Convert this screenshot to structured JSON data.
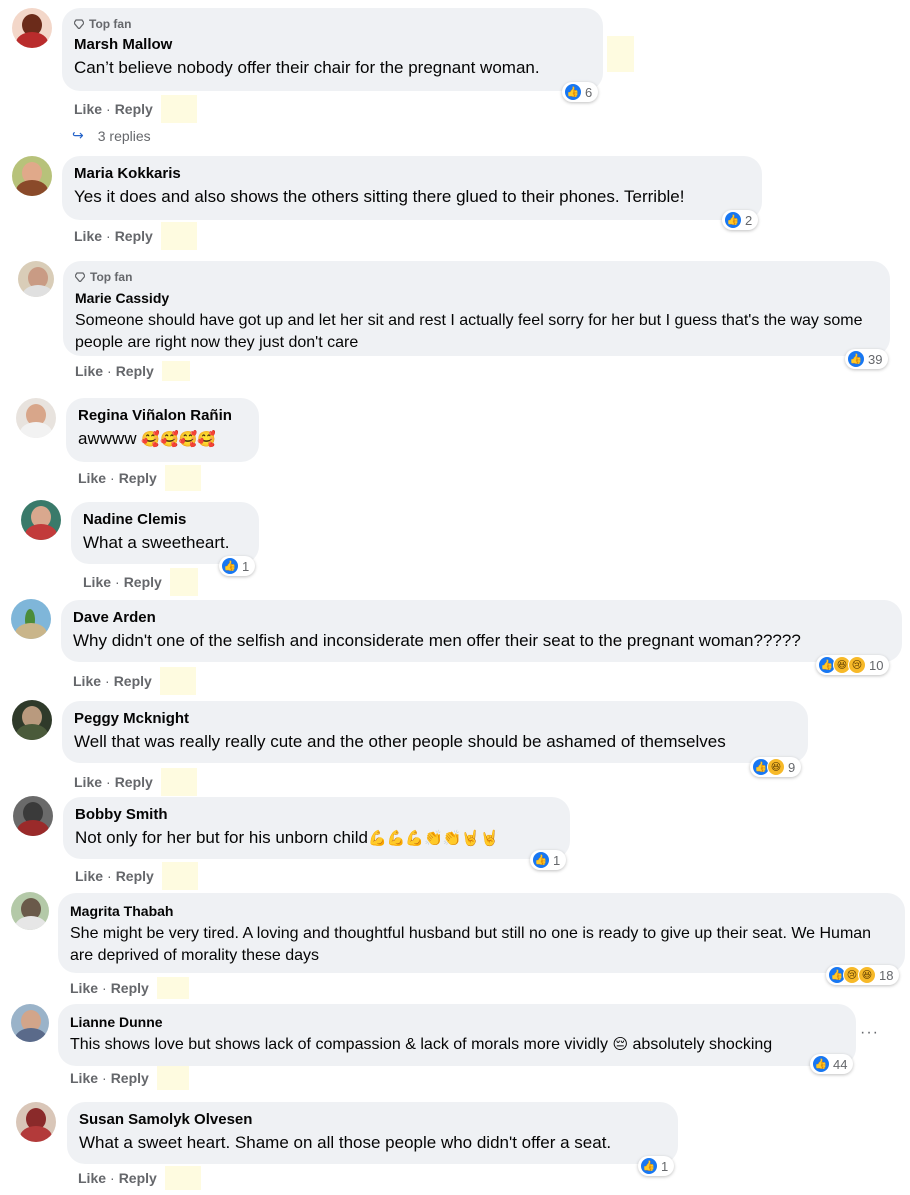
{
  "labels": {
    "top_fan": "Top fan",
    "like": "Like",
    "reply": "Reply",
    "dot": "·"
  },
  "comments": [
    {
      "author": "Marsh Mallow",
      "top_fan": true,
      "text": "Can’t believe nobody offer their chair for the pregnant woman.",
      "reactions": [
        "like"
      ],
      "count": "6",
      "replies": "3 replies"
    },
    {
      "author": "Maria Kokkaris",
      "top_fan": false,
      "text": "Yes it does and also shows the others sitting there glued to their phones. Terrible!",
      "reactions": [
        "like"
      ],
      "count": "2"
    },
    {
      "author": "Marie Cassidy",
      "top_fan": true,
      "text": "Someone should have got up and let her sit and rest I actually feel sorry for her but I guess that's the way some people are right now they just don't care",
      "reactions": [
        "like"
      ],
      "count": "39"
    },
    {
      "author": "Regina Viñalon Rañin",
      "top_fan": false,
      "text": "awwww",
      "emoji": "🥰🥰🥰🥰",
      "reactions": [],
      "count": ""
    },
    {
      "author": "Nadine Clemis",
      "top_fan": false,
      "text": "What a sweetheart.",
      "reactions": [
        "like"
      ],
      "count": "1"
    },
    {
      "author": "Dave Arden",
      "top_fan": false,
      "text": "Why didn't one of the selfish and inconsiderate men offer their seat to the pregnant woman?????",
      "reactions": [
        "like",
        "haha",
        "sad"
      ],
      "count": "10"
    },
    {
      "author": "Peggy Mcknight",
      "top_fan": false,
      "text": "Well that was really really cute and the other people should be ashamed of themselves",
      "reactions": [
        "like",
        "haha"
      ],
      "count": "9"
    },
    {
      "author": "Bobby Smith",
      "top_fan": false,
      "text": "Not only for her but for his unborn child",
      "emoji": "💪💪💪👏👏🤘🤘",
      "reactions": [
        "like"
      ],
      "count": "1"
    },
    {
      "author": "Magrita Thabah",
      "top_fan": false,
      "text": "She might be very tired. A loving and thoughtful husband but still no one is ready to give up their seat. We Human are deprived of morality these days",
      "reactions": [
        "like",
        "sad",
        "haha"
      ],
      "count": "18"
    },
    {
      "author": "Lianne Dunne",
      "top_fan": false,
      "text": "This shows love but shows lack of compassion & lack of morals more vividly",
      "emoji": "😔",
      "text_after": " absolutely shocking",
      "reactions": [
        "like"
      ],
      "count": "44"
    },
    {
      "author": "Susan Samolyk Olvesen",
      "top_fan": false,
      "text": "What a sweet heart. Shame on all those people who didn't offer a seat.",
      "reactions": [
        "like"
      ],
      "count": "1"
    }
  ],
  "more_options": "···",
  "colors": {
    "bubble": "#eff1f4",
    "meta": "#65676b",
    "like_blue": "#1877f2",
    "haha_yellow": "#f7b928",
    "highlight": "#fefbe0"
  },
  "icons": {
    "top_fan": "diamond-icon",
    "reply_arrow": "reply-arrow-icon",
    "like": "thumbs-up-icon",
    "haha": "laughing-face-icon",
    "sad": "crying-face-icon",
    "more": "more-options-icon"
  }
}
